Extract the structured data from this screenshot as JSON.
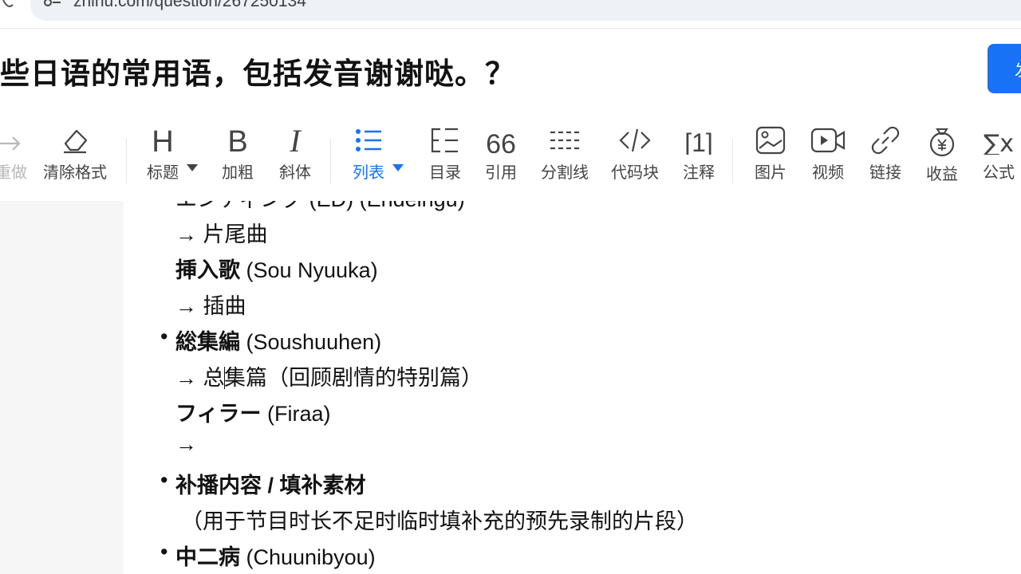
{
  "browser": {
    "url": "zhihu.com/question/267250134"
  },
  "header": {
    "title": "些日语的常用语，包括发音谢谢哒。？",
    "publish_label": "发"
  },
  "toolbar": {
    "redo": "重做",
    "clear_format": "清除格式",
    "heading": "标题",
    "bold": "加粗",
    "italic": "斜体",
    "list": "列表",
    "toc": "目录",
    "quote": "引用",
    "divider": "分割线",
    "code_block": "代码块",
    "annotation": "注释",
    "image": "图片",
    "video": "视频",
    "link": "链接",
    "revenue": "收益",
    "formula": "公式",
    "heading_glyph": "H",
    "bold_glyph": "B",
    "italic_glyph": "I",
    "quote_glyph": "66",
    "annotation_glyph": "[1]",
    "formula_glyph": "∑x",
    "accent_color": "#1772f6"
  },
  "content": {
    "top_partial": "エンディング (ED) (Endeingu)",
    "l1": "→ 片尾曲",
    "l2_bold": "挿入歌",
    "l2_rest": " (Sou Nyuuka)",
    "l3": "→ 插曲",
    "l4_bold": "総集編",
    "l4_rest": " (Soushuuhen)",
    "l5_pre": "→ 总",
    "l5_post": "集篇（回顾剧情的特别篇）",
    "l6_bold": "フィラー",
    "l6_rest": " (Firaa)",
    "l7": "→",
    "l8_bold": "补播内容 / 填补素材",
    "l9": "（用于节目时长不足时临时填补充的预先录制的片段）",
    "l10_bold": "中二病",
    "l10_rest": " (Chuunibyou)",
    "bullet": "•"
  }
}
